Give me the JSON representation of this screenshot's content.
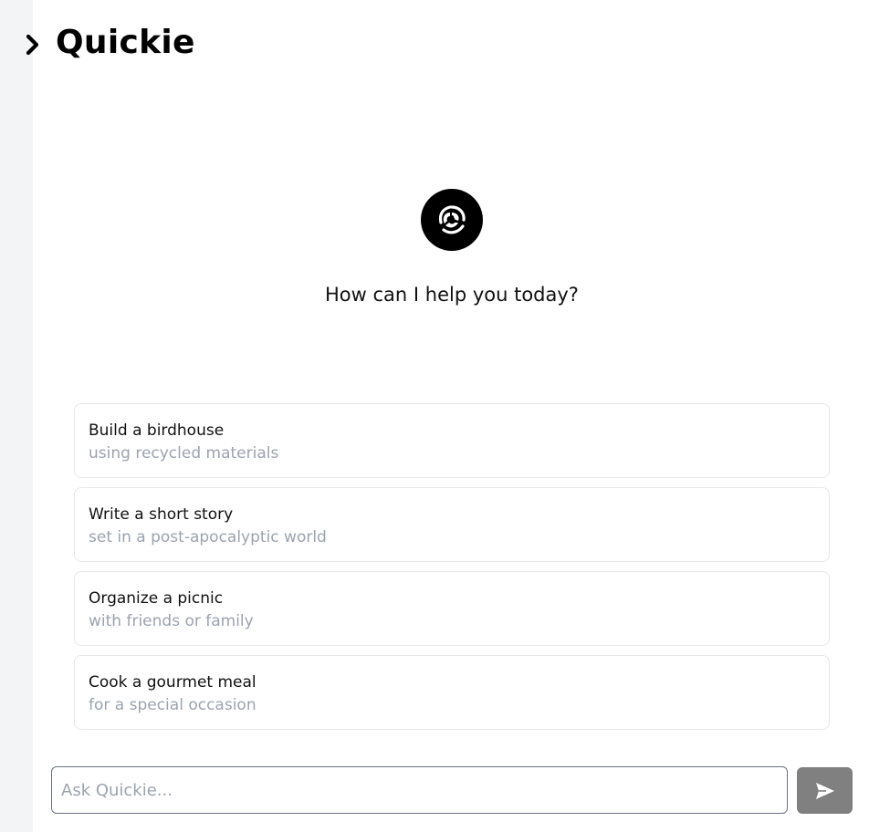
{
  "app": {
    "title": "Quickie"
  },
  "main": {
    "greeting": "How can I help you today?",
    "suggestions": [
      {
        "title": "Build a birdhouse",
        "subtitle": "using recycled materials"
      },
      {
        "title": "Write a short story",
        "subtitle": "set in a post-apocalyptic world"
      },
      {
        "title": "Organize a picnic",
        "subtitle": "with friends or family"
      },
      {
        "title": "Cook a gourmet meal",
        "subtitle": "for a special occasion"
      }
    ]
  },
  "composer": {
    "placeholder": "Ask Quickie...",
    "value": ""
  },
  "icons": {
    "sidebar_toggle": "chevron-right-icon",
    "logo": "aperture-swirl-icon",
    "send": "paper-plane-icon"
  },
  "colors": {
    "sidebar_bg": "#f3f4f6",
    "send_button": "#808080",
    "subtitle_text": "#9ca3af",
    "card_border": "#e5e7eb"
  }
}
